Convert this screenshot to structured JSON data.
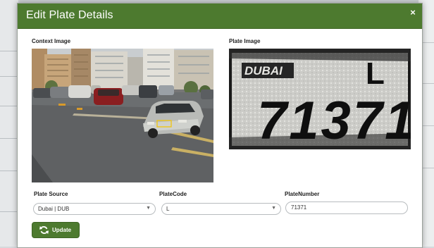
{
  "modal": {
    "title": "Edit Plate Details",
    "close_label": "×"
  },
  "context_image": {
    "label": "Context Image"
  },
  "plate_image": {
    "label": "Plate Image",
    "plate_city_text": "DUBAI",
    "plate_code_text": "L",
    "plate_number_text": "71371"
  },
  "form": {
    "plate_source": {
      "label": "Plate Source",
      "value": "Dubai | DUB"
    },
    "plate_code": {
      "label": "PlateCode",
      "value": "L"
    },
    "plate_number": {
      "label": "PlateNumber",
      "value": "71371"
    }
  },
  "actions": {
    "update_label": "Update"
  },
  "colors": {
    "header": "#4d7a2f",
    "button": "#4d7a2f"
  },
  "icons": {
    "close": "close-icon",
    "refresh": "refresh-icon",
    "dropdown": "chevron-down-icon"
  }
}
